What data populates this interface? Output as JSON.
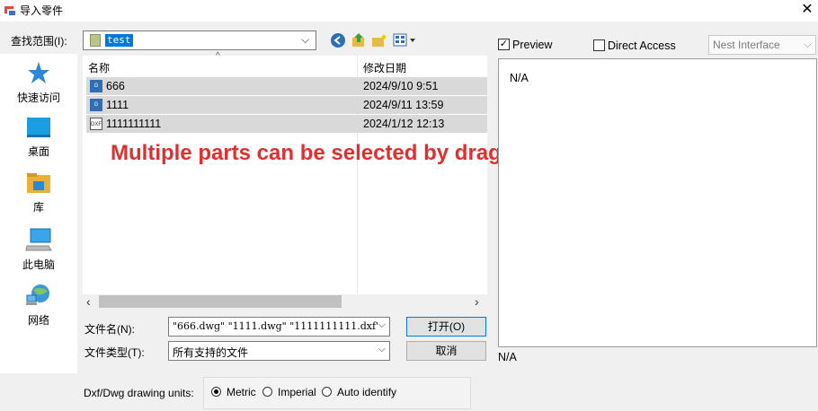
{
  "window": {
    "title": "导入零件",
    "close_glyph": "✕",
    "icon": "app-logo-icon"
  },
  "look_in": {
    "label": "查找范围(I):",
    "value": "test",
    "toolbar_icons": [
      "back-icon",
      "up-folder-icon",
      "new-folder-icon",
      "view-menu-icon"
    ]
  },
  "places": [
    {
      "label": "快速访问",
      "icon": "star-icon"
    },
    {
      "label": "桌面",
      "icon": "desktop-icon"
    },
    {
      "label": "库",
      "icon": "library-icon"
    },
    {
      "label": "此电脑",
      "icon": "computer-icon"
    },
    {
      "label": "网络",
      "icon": "network-icon"
    }
  ],
  "file_list": {
    "columns": {
      "name": "名称",
      "date": "修改日期"
    },
    "rows": [
      {
        "name": "666",
        "date": "2024/9/10 9:51",
        "type": "dwg"
      },
      {
        "name": "1111",
        "date": "2024/9/11 13:59",
        "type": "dwg"
      },
      {
        "name": "1111111111",
        "date": "2024/1/12 12:13",
        "type": "dxf"
      }
    ]
  },
  "annotation": "Multiple parts can be selected by dragging a box.",
  "filename": {
    "label": "文件名(N):",
    "value": "\"666.dwg\" \"1111.dwg\" \"1111111111.dxf\""
  },
  "filetype": {
    "label": "文件类型(T):",
    "value": "所有支持的文件"
  },
  "buttons": {
    "open": "打开(O)",
    "cancel": "取消"
  },
  "units": {
    "label": "Dxf/Dwg drawing units:",
    "options": [
      "Metric",
      "Imperial",
      "Auto identify"
    ],
    "selected": "Metric"
  },
  "preview": {
    "checkbox_label": "Preview",
    "checked": true,
    "na_top": "N/A",
    "na_bottom": "N/A"
  },
  "direct_access": {
    "label": "Direct Access",
    "checked": false
  },
  "nest_interface": {
    "label": "Nest Interface"
  },
  "colors": {
    "selection": "#d9d9d9",
    "accent": "#0078d7",
    "annotation": "#e02f2f"
  }
}
